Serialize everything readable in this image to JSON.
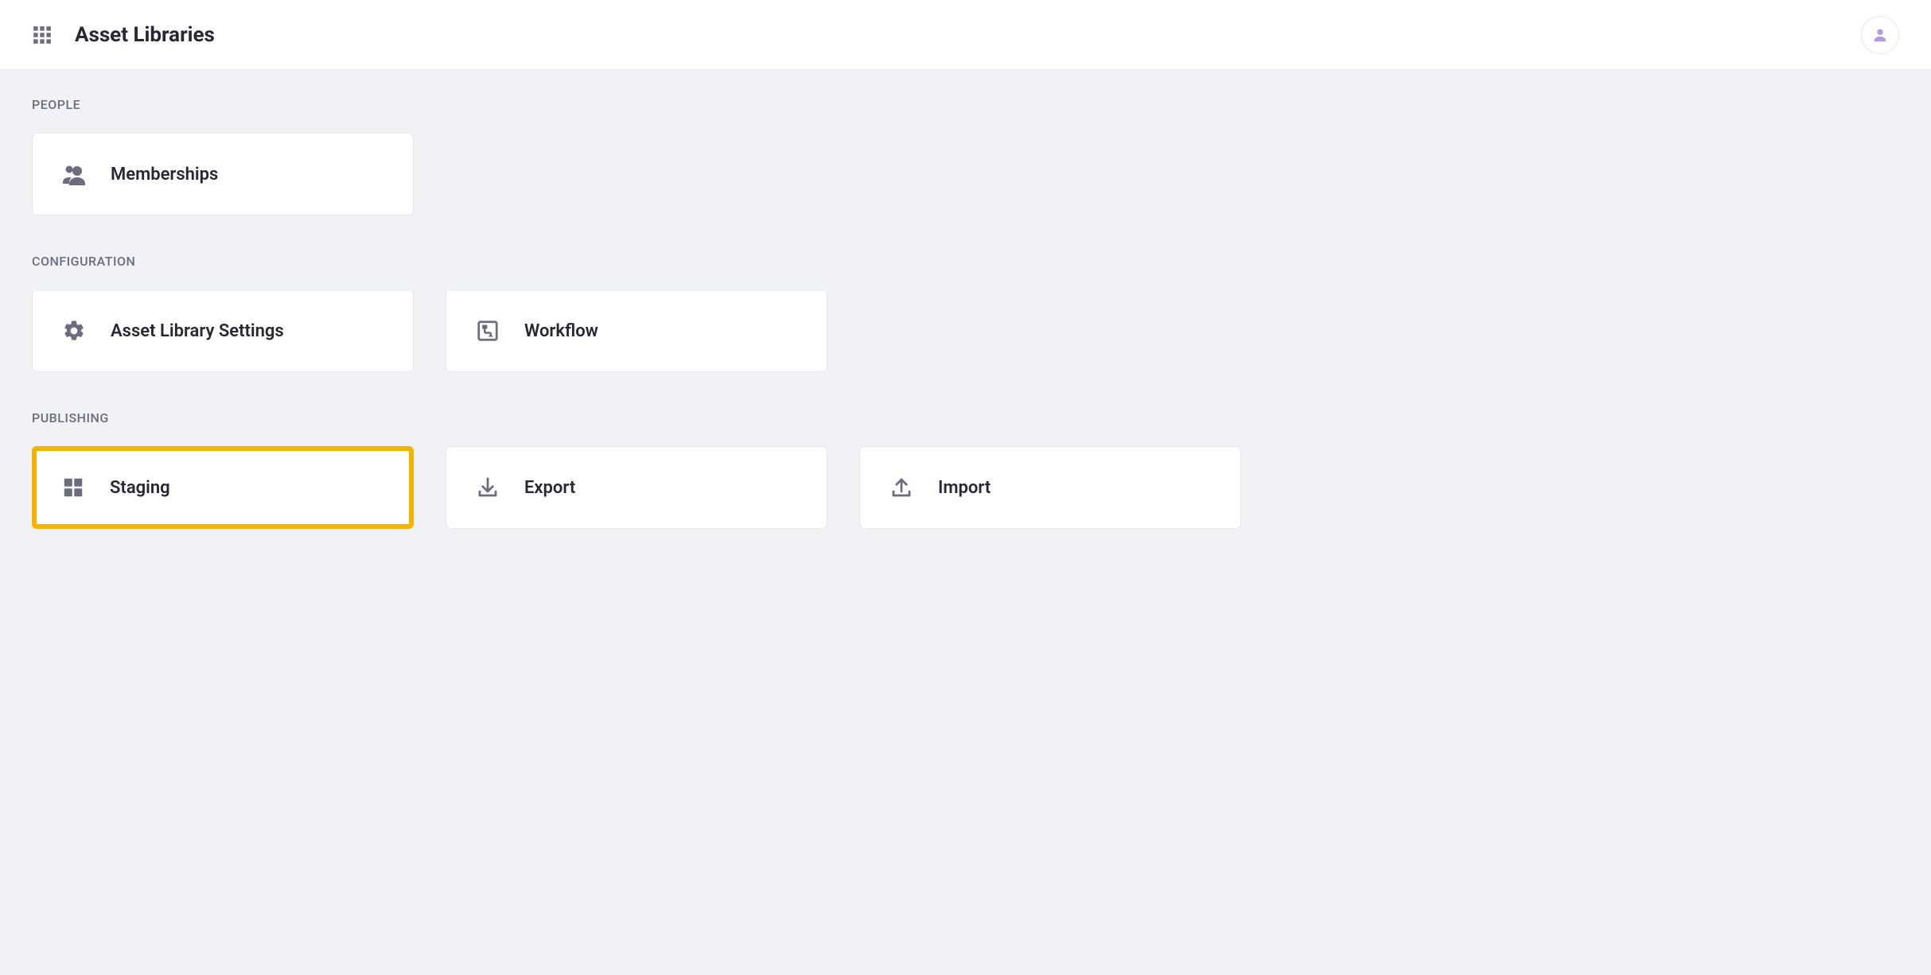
{
  "header": {
    "title": "Asset Libraries"
  },
  "sections": {
    "people": {
      "label": "PEOPLE",
      "cards": {
        "memberships": "Memberships"
      }
    },
    "configuration": {
      "label": "CONFIGURATION",
      "cards": {
        "settings": "Asset Library Settings",
        "workflow": "Workflow"
      }
    },
    "publishing": {
      "label": "PUBLISHING",
      "cards": {
        "staging": "Staging",
        "export": "Export",
        "import": "Import"
      }
    }
  }
}
